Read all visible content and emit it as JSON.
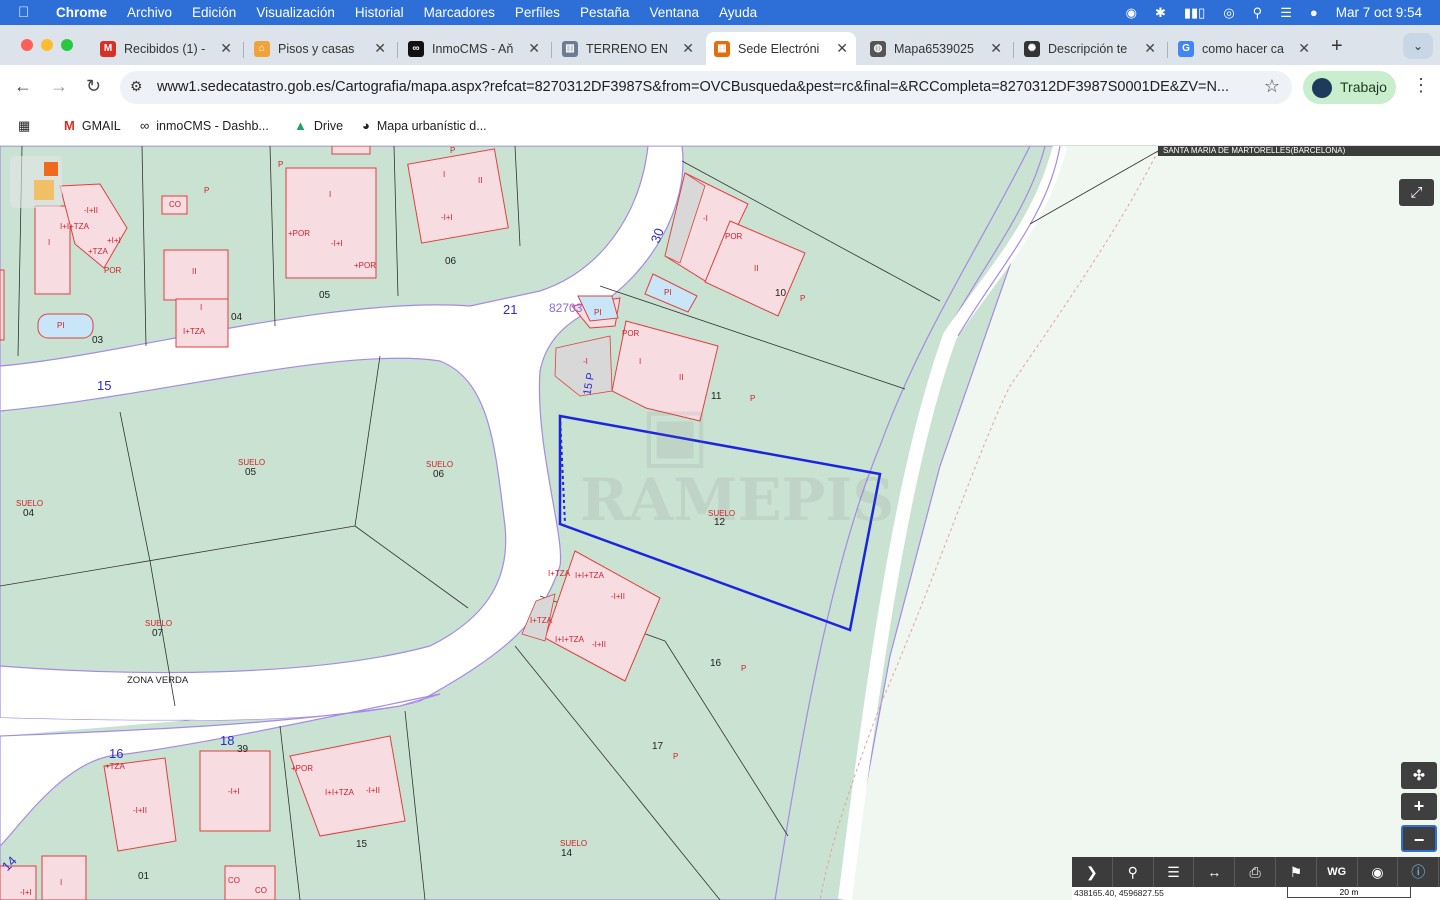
{
  "menubar": {
    "app_name": "Chrome",
    "items": [
      "Archivo",
      "Edición",
      "Visualización",
      "Historial",
      "Marcadores",
      "Perfiles",
      "Pestaña",
      "Ventana",
      "Ayuda"
    ],
    "clock": "Mar 7 oct  9:54"
  },
  "tabs": [
    {
      "title": "Recibidos (1) -",
      "favicon": "gmail-icon",
      "color": "#d93025",
      "glyph": "M"
    },
    {
      "title": "Pisos y casas",
      "favicon": "idealista-icon",
      "color": "#f0a23b",
      "glyph": "⌂"
    },
    {
      "title": "InmoCMS - Aň",
      "favicon": "inmocms-icon",
      "color": "#111111",
      "glyph": "∞"
    },
    {
      "title": "TERRENO EN",
      "favicon": "catastro-icon",
      "color": "#6b7c93",
      "glyph": "▥"
    },
    {
      "title": "Sede Electróni",
      "favicon": "sede-icon",
      "color": "#e46c0a",
      "glyph": "▦"
    },
    {
      "title": "Mapa6539025",
      "favicon": "globe-icon",
      "color": "#555555",
      "glyph": "◍"
    },
    {
      "title": "Descripción te",
      "favicon": "chatgpt-icon",
      "color": "#333333",
      "glyph": "✺"
    },
    {
      "title": "como hacer ca",
      "favicon": "google-icon",
      "color": "#4285f4",
      "glyph": "G"
    }
  ],
  "active_tab": 4,
  "address": {
    "url": "www1.sedecatastro.gob.es/Cartografia/mapa.aspx?refcat=8270312DF3987S&from=OVCBusqueda&pest=rc&final=&RCCompleta=8270312DF3987S0001DE&ZV=N..."
  },
  "profile": {
    "label": "Trabajo"
  },
  "bookmarks": [
    {
      "label": "GMAIL",
      "icon": "gmail-icon"
    },
    {
      "label": "inmoCMS - Dashb...",
      "icon": "inmocms-icon"
    },
    {
      "label": "Drive",
      "icon": "drive-icon"
    },
    {
      "label": "Mapa urbanístic d...",
      "icon": "globe-icon"
    }
  ],
  "map": {
    "municipality": "SANTA MARIA DE MARTORELLES(BARCELONA)",
    "watermark": "RAMEPIS",
    "coordinates": "438165.40, 4596827.55",
    "scale": "20 m",
    "street_numbers": [
      "15",
      "21",
      "30",
      "16",
      "18",
      "39",
      "14"
    ],
    "block_ref": "82703",
    "parcel_numbers": [
      "03",
      "04",
      "05",
      "06",
      "10",
      "11",
      "12",
      "16",
      "17",
      "01",
      "15",
      "14",
      "05",
      "06",
      "04",
      "07"
    ],
    "building_labels": [
      "I",
      "II",
      "-I+II",
      "I+I+TZA",
      "+I+I",
      "+TZA",
      "CO",
      "PI",
      "I+TZA",
      "+POR",
      "-I+I",
      "POR",
      "-I",
      "P",
      "SUELO",
      "ZONA VERDA",
      "15 P"
    ],
    "tools": [
      "forward-icon",
      "search-icon",
      "layers-icon",
      "measure-icon",
      "print-icon",
      "parcel-icon",
      "wms-icon",
      "binoculars-icon",
      "info-icon"
    ]
  }
}
